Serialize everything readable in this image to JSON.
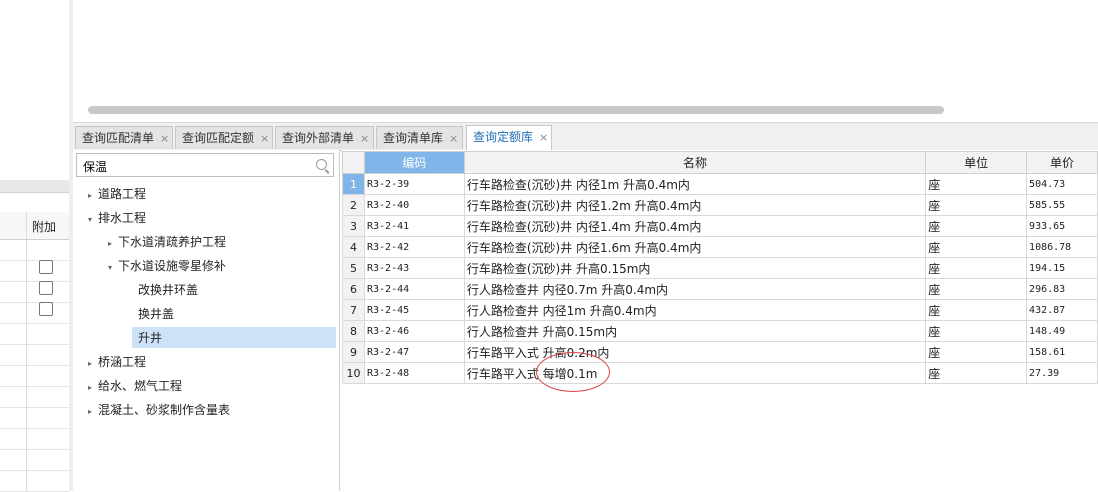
{
  "left_panel": {
    "column_header": "附加",
    "checkbox_rows": [
      {
        "checked": false
      },
      {
        "checked": false
      },
      {
        "checked": false
      }
    ]
  },
  "tabs": [
    {
      "label": "查询匹配清单",
      "close": "×",
      "active": false
    },
    {
      "label": "查询匹配定额",
      "close": "×",
      "active": false
    },
    {
      "label": "查询外部清单",
      "close": "×",
      "active": false
    },
    {
      "label": "查询清单库",
      "close": "×",
      "active": false
    },
    {
      "label": "查询定额库",
      "close": "×",
      "active": true
    }
  ],
  "search": {
    "value": "保温",
    "icon": "search-icon"
  },
  "tree": [
    {
      "label": "道路工程",
      "level": 0,
      "arrow": "▸"
    },
    {
      "label": "排水工程",
      "level": 0,
      "arrow": "▾"
    },
    {
      "label": "下水道清疏养护工程",
      "level": 1,
      "arrow": "▸"
    },
    {
      "label": "下水道设施零星修补",
      "level": 1,
      "arrow": "▾"
    },
    {
      "label": "改换井环盖",
      "level": 2,
      "arrow": ""
    },
    {
      "label": "换井盖",
      "level": 2,
      "arrow": ""
    },
    {
      "label": "升井",
      "level": 2,
      "arrow": "",
      "selected": true
    },
    {
      "label": "桥涵工程",
      "level": 0,
      "arrow": "▸"
    },
    {
      "label": "给水、燃气工程",
      "level": 0,
      "arrow": "▸"
    },
    {
      "label": "混凝土、砂浆制作含量表",
      "level": 0,
      "arrow": "▸"
    }
  ],
  "grid": {
    "headers": {
      "code": "编码",
      "name": "名称",
      "unit": "单位",
      "price": "单价"
    },
    "rows": [
      {
        "n": "1",
        "code": "R3-2-39",
        "name": "行车路检查(沉砂)井 内径1m 升高0.4m内",
        "unit": "座",
        "price": "504.73"
      },
      {
        "n": "2",
        "code": "R3-2-40",
        "name": "行车路检查(沉砂)井 内径1.2m 升高0.4m内",
        "unit": "座",
        "price": "585.55"
      },
      {
        "n": "3",
        "code": "R3-2-41",
        "name": "行车路检查(沉砂)井 内径1.4m 升高0.4m内",
        "unit": "座",
        "price": "933.65"
      },
      {
        "n": "4",
        "code": "R3-2-42",
        "name": "行车路检查(沉砂)井 内径1.6m 升高0.4m内",
        "unit": "座",
        "price": "1086.78"
      },
      {
        "n": "5",
        "code": "R3-2-43",
        "name": "行车路检查(沉砂)井 升高0.15m内",
        "unit": "座",
        "price": "194.15"
      },
      {
        "n": "6",
        "code": "R3-2-44",
        "name": "行人路检查井 内径0.7m 升高0.4m内",
        "unit": "座",
        "price": "296.83"
      },
      {
        "n": "7",
        "code": "R3-2-45",
        "name": "行人路检查井 内径1m 升高0.4m内",
        "unit": "座",
        "price": "432.87"
      },
      {
        "n": "8",
        "code": "R3-2-46",
        "name": "行人路检查井 升高0.15m内",
        "unit": "座",
        "price": "148.49"
      },
      {
        "n": "9",
        "code": "R3-2-47",
        "name": "行车路平入式 升高0.2m内",
        "unit": "座",
        "price": "158.61"
      },
      {
        "n": "10",
        "code": "R3-2-48",
        "name": "行车路平入式 每增0.1m",
        "unit": "座",
        "price": "27.39"
      }
    ]
  },
  "colors": {
    "accent": "#1f6fb7",
    "selection": "#7fb5e8",
    "tree_selection": "#cde2f7",
    "annotation": "#dd4444"
  }
}
